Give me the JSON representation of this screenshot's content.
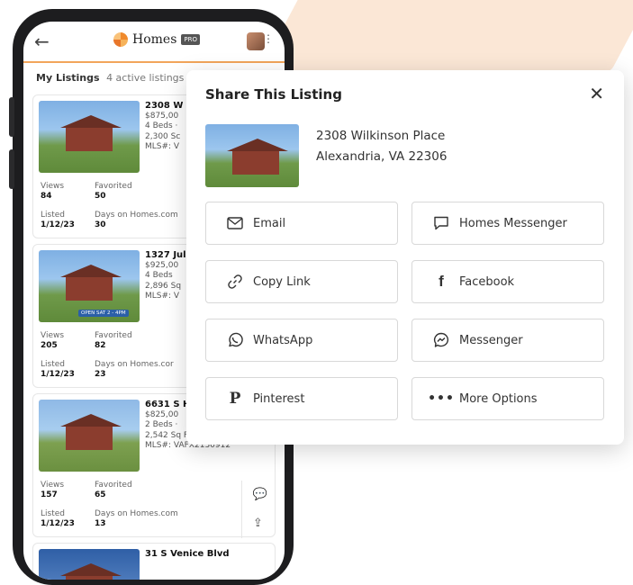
{
  "app": {
    "brand": "Homes",
    "brand_badge": "PRO"
  },
  "listings": {
    "title": "My Listings",
    "count": "4 active listings",
    "cards": [
      {
        "address": "2308 W",
        "price": "$875,00",
        "beds": "4 Beds ·",
        "sqft": "2,300 Sc",
        "mls": "MLS#: V",
        "views_label": "Views",
        "views": "84",
        "fav_label": "Favorited",
        "fav": "50",
        "listed_label": "Listed",
        "listed": "1/12/23",
        "days_label": "Days on Homes.com",
        "days": "30"
      },
      {
        "address": "1327 Jul",
        "price": "$925,00",
        "beds": "4 Beds",
        "sqft": "2,896 Sq",
        "mls": "MLS#: V",
        "badge": "OPEN SAT 2 - 4PM",
        "views_label": "Views",
        "views": "205",
        "fav_label": "Favorited",
        "fav": "82",
        "listed_label": "Listed",
        "listed": "1/12/23",
        "days_label": "Days on Homes.cor",
        "days": "23"
      },
      {
        "address": "6631 S H",
        "price": "$825,00",
        "beds": "2 Beds ·",
        "sqft": "2,542 Sq Ft",
        "mls": "MLS#: VAFX2130912",
        "views_label": "Views",
        "views": "157",
        "fav_label": "Favorited",
        "fav": "65",
        "listed_label": "Listed",
        "listed": "1/12/23",
        "days_label": "Days on Homes.com",
        "days": "13"
      }
    ],
    "next_address": "31 S Venice Blvd"
  },
  "share_modal": {
    "title": "Share This Listing",
    "address_line1": "2308 Wilkinson Place",
    "address_line2": "Alexandria, VA 22306",
    "options": [
      {
        "label": "Email",
        "icon": "envelope-icon"
      },
      {
        "label": "Homes Messenger",
        "icon": "chat-bubble-icon"
      },
      {
        "label": "Copy Link",
        "icon": "link-icon"
      },
      {
        "label": "Facebook",
        "icon": "facebook-icon"
      },
      {
        "label": "WhatsApp",
        "icon": "whatsapp-icon"
      },
      {
        "label": "Messenger",
        "icon": "messenger-icon"
      },
      {
        "label": "Pinterest",
        "icon": "pinterest-icon"
      },
      {
        "label": "More Options",
        "icon": "more-dots-icon"
      }
    ]
  },
  "colors": {
    "accent": "#f2a55a",
    "background_shape": "#fbe7d6"
  }
}
